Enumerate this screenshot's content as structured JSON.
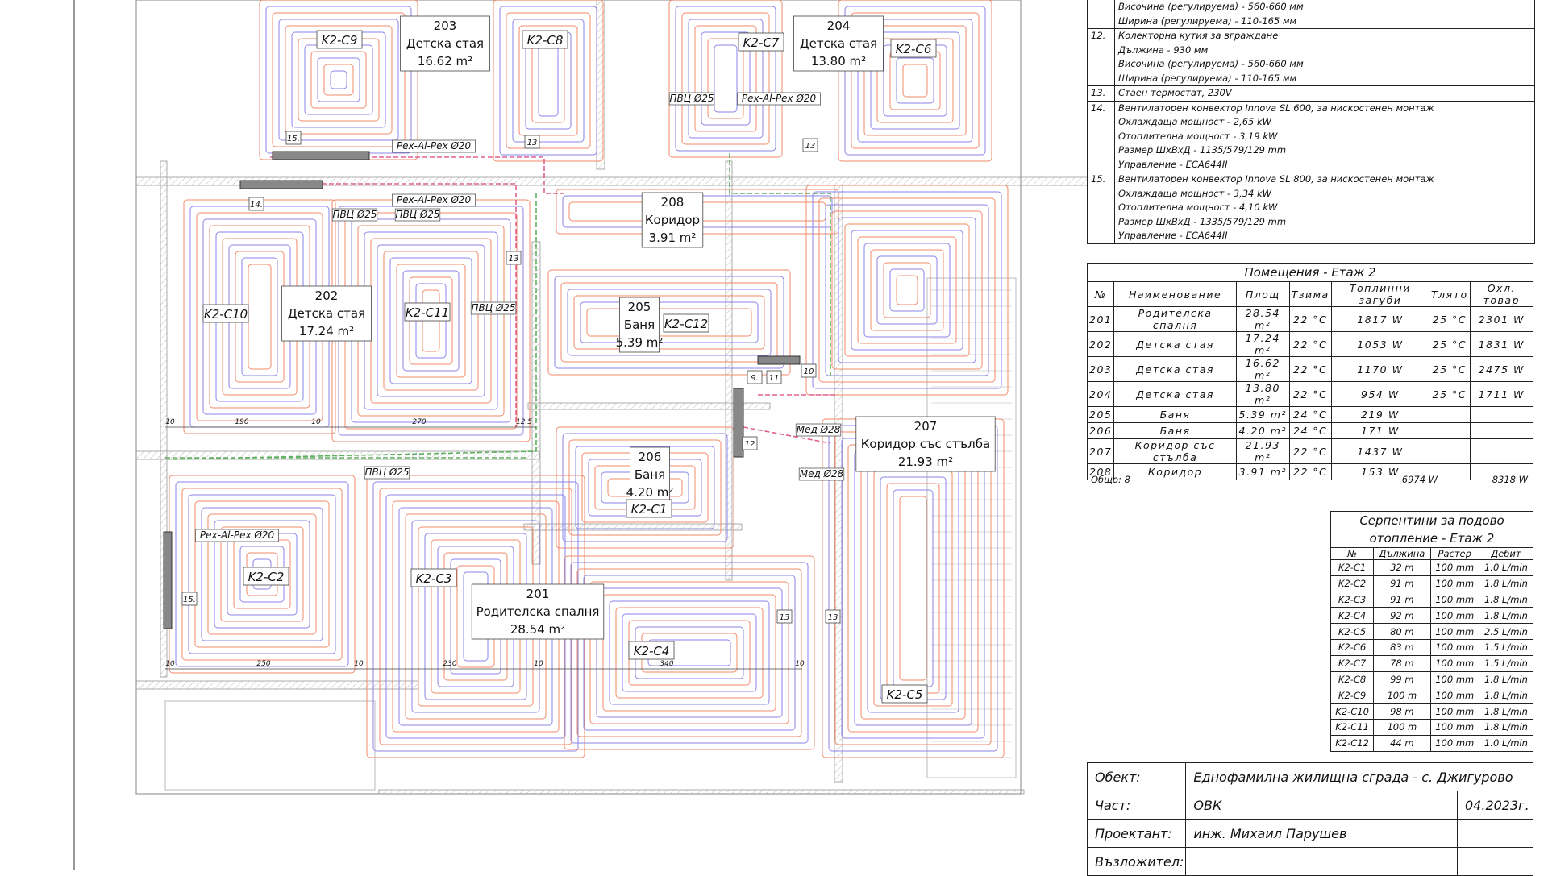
{
  "rooms_on_plan": [
    {
      "no": "201",
      "name": "Родителска спалня",
      "area": "28.54 m²"
    },
    {
      "no": "202",
      "name": "Детска стая",
      "area": "17.24 m²"
    },
    {
      "no": "203",
      "name": "Детска стая",
      "area": "16.62 m²"
    },
    {
      "no": "204",
      "name": "Детска стая",
      "area": "13.80 m²"
    },
    {
      "no": "205",
      "name": "Баня",
      "area": "5.39 m²"
    },
    {
      "no": "206",
      "name": "Баня",
      "area": "4.20 m²"
    },
    {
      "no": "207",
      "name": "Коридор със стълба",
      "area": "21.93 m²"
    },
    {
      "no": "208",
      "name": "Коридор",
      "area": "3.91 m²"
    }
  ],
  "circuit_tags": [
    "K2-C1",
    "K2-C2",
    "K2-C3",
    "K2-C4",
    "K2-C5",
    "K2-C6",
    "K2-C7",
    "K2-C8",
    "K2-C9",
    "K2-C10",
    "K2-C11",
    "K2-C12"
  ],
  "pipe_labels": {
    "pex": "Pex-Al-Pex Ø20",
    "pvc": "ПВЦ Ø25",
    "copper": "Мед Ø28"
  },
  "markers": [
    "9.",
    "10",
    "11",
    "12",
    "13",
    "14.",
    "15."
  ],
  "dimensions": [
    "10",
    "190",
    "10",
    "270",
    "12.5",
    "10",
    "250",
    "10",
    "230",
    "10",
    "340",
    "10"
  ],
  "legend": [
    {
      "no": "",
      "lines": [
        "Височина (регулируема) - 560-660 мм",
        "Ширина (регулируема) - 110-165 мм"
      ]
    },
    {
      "no": "12.",
      "lines": [
        "Колекторна кутия за вграждане",
        "Дължина - 930 мм",
        "Височина (регулируема) - 560-660 мм",
        "Ширина (регулируема) - 110-165 мм"
      ]
    },
    {
      "no": "13.",
      "lines": [
        "Стаен термостат, 230V"
      ]
    },
    {
      "no": "14.",
      "lines": [
        "Вентилаторен конвектор Innova SL 600, за нискостенен монтаж",
        "Охлаждаща мощност - 2,65 kW",
        "Отоплителна мощност - 3,19 kW",
        "Размер ШхВхД - 1135/579/129 mm",
        "Управление - ECA644II"
      ]
    },
    {
      "no": "15.",
      "lines": [
        "Вентилаторен конвектор Innova SL 800, за нискостенен монтаж",
        "Охлаждаща мощност - 3,34 kW",
        "Отоплителна мощност - 4,10 kW",
        "Размер ШхВхД - 1335/579/129 mm",
        "Управление - ECA644II"
      ]
    }
  ],
  "rooms_table": {
    "caption": "Помещения - Етаж 2",
    "headers": [
      "№",
      "Наименование",
      "Площ",
      "Тзима",
      "Топлинни загуби",
      "Тлято",
      "Охл. товар"
    ],
    "rows": [
      [
        "201",
        "Родителска спалня",
        "28.54 m²",
        "22 °C",
        "1817 W",
        "25 °C",
        "2301 W"
      ],
      [
        "202",
        "Детска стая",
        "17.24 m²",
        "22 °C",
        "1053 W",
        "25 °C",
        "1831 W"
      ],
      [
        "203",
        "Детска стая",
        "16.62 m²",
        "22 °C",
        "1170 W",
        "25 °C",
        "2475 W"
      ],
      [
        "204",
        "Детска стая",
        "13.80 m²",
        "22 °C",
        "954 W",
        "25 °C",
        "1711 W"
      ],
      [
        "205",
        "Баня",
        "5.39 m²",
        "24 °C",
        "219 W",
        "",
        ""
      ],
      [
        "206",
        "Баня",
        "4.20 m²",
        "24 °C",
        "171 W",
        "",
        ""
      ],
      [
        "207",
        "Коридор със стълба",
        "21.93 m²",
        "22 °C",
        "1437 W",
        "",
        ""
      ],
      [
        "208",
        "Коридор",
        "3.91 m²",
        "22 °C",
        "153 W",
        "",
        ""
      ]
    ],
    "total_label": "Общо: 8",
    "total_heat": "6974 W",
    "total_cool": "8318 W"
  },
  "circuits_table": {
    "caption_1": "Серпентини за подово",
    "caption_2": "отопление - Етаж 2",
    "headers": [
      "№",
      "Дължина",
      "Растер",
      "Дебит"
    ],
    "rows": [
      [
        "K2-C1",
        "32 m",
        "100 mm",
        "1.0 L/min"
      ],
      [
        "K2-C2",
        "91 m",
        "100 mm",
        "1.8 L/min"
      ],
      [
        "K2-C3",
        "91 m",
        "100 mm",
        "1.8 L/min"
      ],
      [
        "K2-C4",
        "92 m",
        "100 mm",
        "1.8 L/min"
      ],
      [
        "K2-C5",
        "80 m",
        "100 mm",
        "2.5 L/min"
      ],
      [
        "K2-C6",
        "83 m",
        "100 mm",
        "1.5 L/min"
      ],
      [
        "K2-C7",
        "78 m",
        "100 mm",
        "1.5 L/min"
      ],
      [
        "K2-C8",
        "99 m",
        "100 mm",
        "1.8 L/min"
      ],
      [
        "K2-C9",
        "100 m",
        "100 mm",
        "1.8 L/min"
      ],
      [
        "K2-C10",
        "98 m",
        "100 mm",
        "1.8 L/min"
      ],
      [
        "K2-C11",
        "100 m",
        "100 mm",
        "1.8 L/min"
      ],
      [
        "K2-C12",
        "44 m",
        "100 mm",
        "1.0 L/min"
      ]
    ]
  },
  "title_block": {
    "object_label": "Обект:",
    "object_value": "Еднофамилна жилищна сграда -  с. Джигурово",
    "part_label": "Част:",
    "part_value": "ОВК",
    "date": "04.2023г.",
    "designer_label": "Проектант:",
    "designer_value": "инж. Михаил Парушев",
    "cut_label": "Възложител:"
  },
  "colors": {
    "supply": "#f08a6a",
    "return": "#8a86e8",
    "wall": "#9a9a9a",
    "green": "#6cc06c",
    "frame": "#222222"
  }
}
